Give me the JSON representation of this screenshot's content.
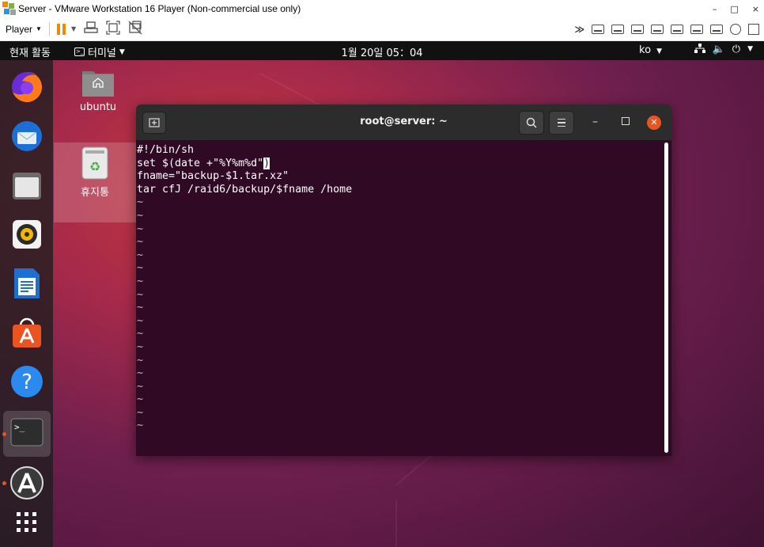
{
  "vmware": {
    "title": "Server - VMware Workstation 16 Player (Non-commercial use only)",
    "window_controls": [
      "–",
      "□",
      "×"
    ],
    "toolbar": {
      "player_label": "Player",
      "icons": [
        "pause-icon",
        "send-ctrl-alt-del-icon",
        "fit-guest-icon",
        "unity-icon"
      ],
      "device_icons": [
        "hdd-icon",
        "cd-icon",
        "network-icon",
        "usb-icon",
        "sound-icon",
        "printer-icon",
        "display-icon",
        "settings-icon",
        "message-icon"
      ]
    }
  },
  "topbar": {
    "activities": "현재 활동",
    "app_menu": "터미널",
    "clock": "1월 20일  05：04",
    "lang": "ko",
    "tray_icons": [
      "network-icon",
      "volume-icon",
      "power-icon"
    ]
  },
  "dock": {
    "items": [
      "firefox",
      "thunderbird",
      "files",
      "rhythmbox",
      "libreoffice-writer",
      "ubuntu-software",
      "help",
      "terminal",
      "updates",
      "show-applications"
    ]
  },
  "desktop": {
    "home_label": "ubuntu",
    "trash_label": "휴지통"
  },
  "terminal": {
    "title": "root@server: ~",
    "lines": [
      "#!/bin/sh",
      "",
      "set $(date +\"%Y%m%d\"",
      "fname=\"backup-$1.tar.xz\"",
      "tar cfJ /raid6/backup/$fname /home"
    ],
    "cursor_char": ")",
    "tilde": "~",
    "tilde_count": 18
  },
  "colors": {
    "ubuntu_orange": "#e95420",
    "terminal_bg": "#300a24",
    "vmware_pause": "#f08a00"
  }
}
